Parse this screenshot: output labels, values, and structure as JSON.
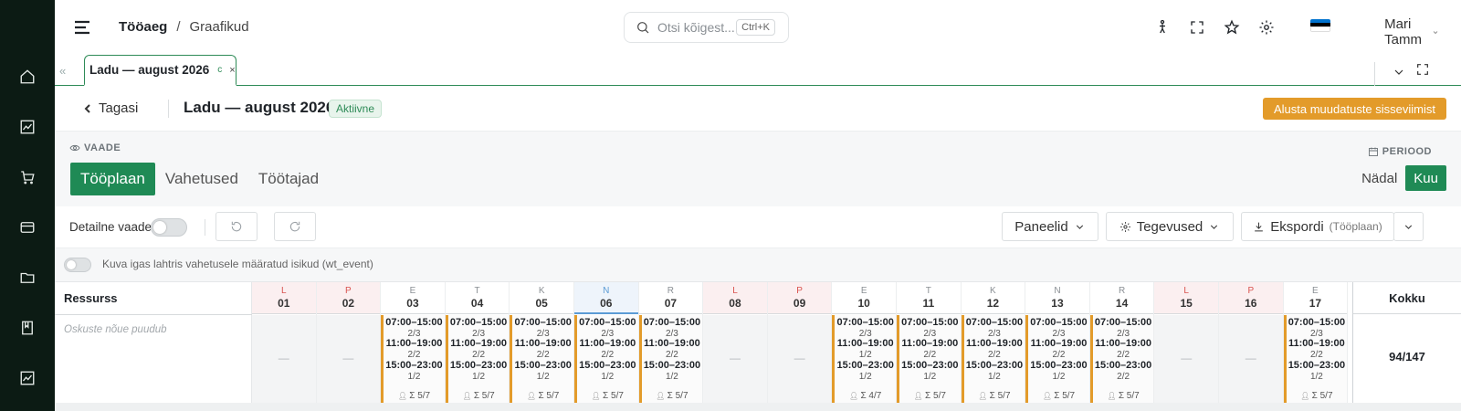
{
  "header": {
    "breadcrumb_1": "Tööaeg",
    "breadcrumb_sep": "/",
    "breadcrumb_2": "Graafikud",
    "search_placeholder": "Otsi kõigest...",
    "search_shortcut": "Ctrl+K",
    "user_name": "Mari Tamm",
    "flag_colors": [
      "#0072ce",
      "#000000",
      "#ffffff"
    ]
  },
  "tab": {
    "label": "Ladu — august 2026",
    "refresh_icon": "c",
    "close_icon": "×"
  },
  "page": {
    "back_label": "Tagasi",
    "title": "Ladu — august 2026",
    "status": "Aktiivne",
    "action_button": "Alusta muudatuste sisseviimist",
    "accent_color": "#1f8a55",
    "action_color": "#e39b2a"
  },
  "view": {
    "label": "VAADE",
    "tabs": [
      "Tööplaan",
      "Vahetused",
      "Töötajad"
    ],
    "active": "Tööplaan",
    "period_label": "PERIOOD",
    "period_tabs": [
      "Nädal",
      "Kuu"
    ],
    "period_active": "Kuu"
  },
  "toolbar": {
    "detail_view": "Detailne vaade",
    "panels": "Paneelid",
    "activities": "Tegevused",
    "export": "Ekspordi",
    "export_sub": "(Tööplaan)"
  },
  "info": {
    "toggle_text": "Kuva igas lahtris vahetusele määratud isikud (wt_event)"
  },
  "grid": {
    "resource_header": "Ressurss",
    "resource_note": "Oskuste nõue puudub",
    "total_header": "Kokku",
    "total_value": "94/147",
    "empty_mark": "—",
    "days": [
      {
        "letter": "L",
        "num": "01",
        "type": "weekend"
      },
      {
        "letter": "P",
        "num": "02",
        "type": "weekend"
      },
      {
        "letter": "E",
        "num": "03",
        "type": "work",
        "shifts": [
          [
            "07:00–15:00",
            "2/3"
          ],
          [
            "11:00–19:00",
            "2/2"
          ],
          [
            "15:00–23:00",
            "1/2"
          ]
        ],
        "sum": "Σ 5/7"
      },
      {
        "letter": "T",
        "num": "04",
        "type": "work",
        "shifts": [
          [
            "07:00–15:00",
            "2/3"
          ],
          [
            "11:00–19:00",
            "2/2"
          ],
          [
            "15:00–23:00",
            "1/2"
          ]
        ],
        "sum": "Σ 5/7"
      },
      {
        "letter": "K",
        "num": "05",
        "type": "work",
        "shifts": [
          [
            "07:00–15:00",
            "2/3"
          ],
          [
            "11:00–19:00",
            "2/2"
          ],
          [
            "15:00–23:00",
            "1/2"
          ]
        ],
        "sum": "Σ 5/7"
      },
      {
        "letter": "N",
        "num": "06",
        "type": "work",
        "today": true,
        "shifts": [
          [
            "07:00–15:00",
            "2/3"
          ],
          [
            "11:00–19:00",
            "2/2"
          ],
          [
            "15:00–23:00",
            "1/2"
          ]
        ],
        "sum": "Σ 5/7"
      },
      {
        "letter": "R",
        "num": "07",
        "type": "work",
        "shifts": [
          [
            "07:00–15:00",
            "2/3"
          ],
          [
            "11:00–19:00",
            "2/2"
          ],
          [
            "15:00–23:00",
            "1/2"
          ]
        ],
        "sum": "Σ 5/7"
      },
      {
        "letter": "L",
        "num": "08",
        "type": "weekend"
      },
      {
        "letter": "P",
        "num": "09",
        "type": "weekend"
      },
      {
        "letter": "E",
        "num": "10",
        "type": "work",
        "shifts": [
          [
            "07:00–15:00",
            "2/3"
          ],
          [
            "11:00–19:00",
            "1/2"
          ],
          [
            "15:00–23:00",
            "1/2"
          ]
        ],
        "sum": "Σ 4/7"
      },
      {
        "letter": "T",
        "num": "11",
        "type": "work",
        "shifts": [
          [
            "07:00–15:00",
            "2/3"
          ],
          [
            "11:00–19:00",
            "2/2"
          ],
          [
            "15:00–23:00",
            "1/2"
          ]
        ],
        "sum": "Σ 5/7"
      },
      {
        "letter": "K",
        "num": "12",
        "type": "work",
        "shifts": [
          [
            "07:00–15:00",
            "2/3"
          ],
          [
            "11:00–19:00",
            "2/2"
          ],
          [
            "15:00–23:00",
            "1/2"
          ]
        ],
        "sum": "Σ 5/7"
      },
      {
        "letter": "N",
        "num": "13",
        "type": "work",
        "shifts": [
          [
            "07:00–15:00",
            "2/3"
          ],
          [
            "11:00–19:00",
            "2/2"
          ],
          [
            "15:00–23:00",
            "1/2"
          ]
        ],
        "sum": "Σ 5/7"
      },
      {
        "letter": "R",
        "num": "14",
        "type": "work",
        "shifts": [
          [
            "07:00–15:00",
            "2/3"
          ],
          [
            "11:00–19:00",
            "2/2"
          ],
          [
            "15:00–23:00",
            "2/2"
          ]
        ],
        "sum": "Σ 5/7"
      },
      {
        "letter": "L",
        "num": "15",
        "type": "weekend"
      },
      {
        "letter": "P",
        "num": "16",
        "type": "weekend"
      },
      {
        "letter": "E",
        "num": "17",
        "type": "work",
        "shifts": [
          [
            "07:00–15:00",
            "2/3"
          ],
          [
            "11:00–19:00",
            "2/2"
          ],
          [
            "15:00–23:00",
            "1/2"
          ]
        ],
        "sum": "Σ 5/7"
      }
    ]
  }
}
